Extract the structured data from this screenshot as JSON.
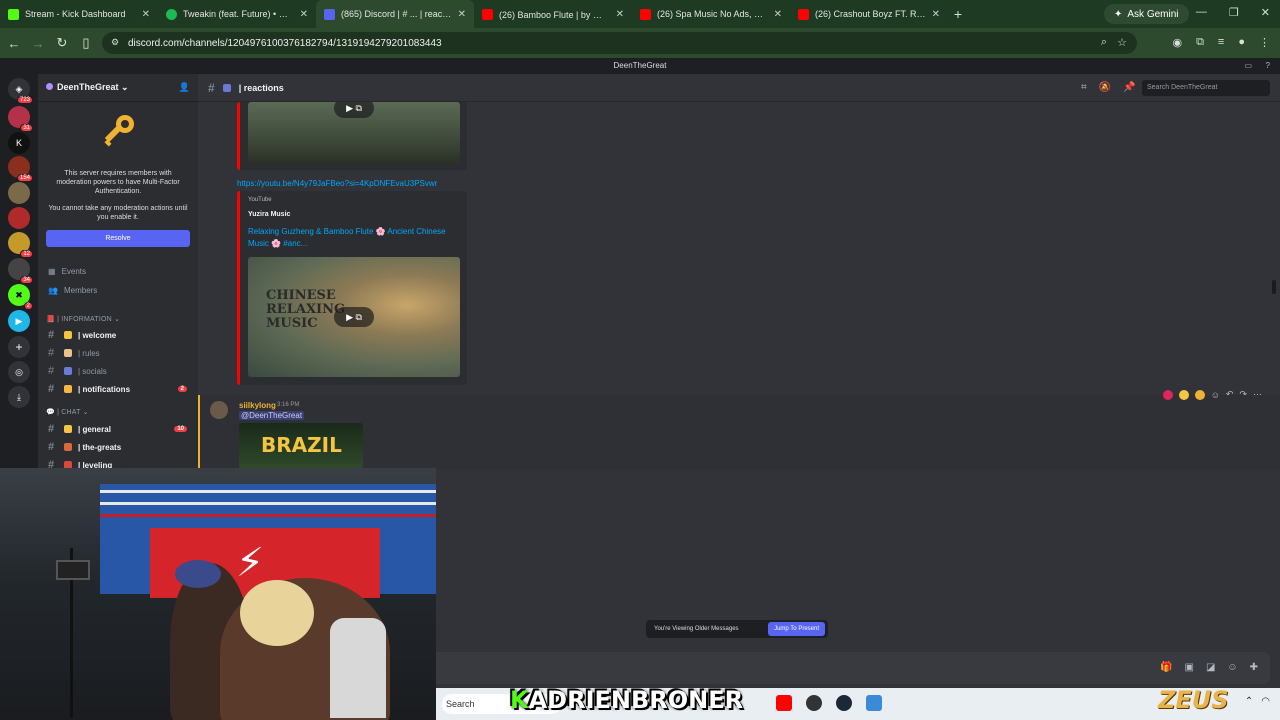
{
  "browser": {
    "tabs": [
      {
        "label": "Stream - Kick Dashboard",
        "color": "#53fc18"
      },
      {
        "label": "Tweakin (feat. Future) • Doe Bo...",
        "color": "#1db954"
      },
      {
        "label": "(865) Discord | # ... | reactions",
        "color": "#5865f2",
        "active": true
      },
      {
        "label": "(26) Bamboo Flute | by 陳悅 - Y...",
        "color": "#ff0000"
      },
      {
        "label": "(26) Spa Music No Ads, Relax M...",
        "color": "#ff0000"
      },
      {
        "label": "(26) Crashout Boyz FT. Ralfy- 19...",
        "color": "#ff0000"
      }
    ],
    "new_tab": "+",
    "ask_gemini": "Ask Gemini",
    "url": "discord.com/channels/1204976100376182794/1319194279201083443"
  },
  "discord": {
    "window_title": "DeenTheGreat",
    "rail": [
      {
        "badge": "723"
      },
      {
        "badge": "31"
      },
      {
        "badge": ""
      },
      {
        "badge": "154"
      },
      {
        "badge": ""
      },
      {
        "badge": ""
      },
      {
        "badge": "12"
      },
      {
        "badge": "34"
      },
      {
        "badge": "2"
      },
      {
        "badge": ""
      }
    ],
    "server_name": "DeenTheGreat",
    "mfa_notice": "This server requires members with moderation powers to have Multi-Factor Authentication.",
    "mfa_sub": "You cannot take any moderation actions until you enable it.",
    "resolve_label": "Resolve",
    "events_label": "Events",
    "members_label": "Members",
    "cat_information": "| INFORMATION ⌄",
    "cat_chat": "| CHAT ⌄",
    "channels": [
      {
        "name": "| welcome",
        "bright": true
      },
      {
        "name": "| rules"
      },
      {
        "name": "| socials"
      },
      {
        "name": "| notifications",
        "bright": true,
        "badge": "2"
      },
      {
        "name": "| general",
        "bright": true,
        "badge": "10"
      },
      {
        "name": "| the-greats",
        "bright": true
      },
      {
        "name": "| leveling",
        "bright": true
      }
    ],
    "channel_header": "| reactions",
    "search_placeholder": "Search DeenTheGreat",
    "message1": {
      "link": "https://youtu.be/N4y79JaFBeo?si=4KpDNFEvaU3PSvwr",
      "provider": "YouTube",
      "author": "Yuzira Music",
      "title": "Relaxing Guzheng & Bamboo Flute 🌸 Ancient Chinese Music 🌸 #anc...",
      "thumb_text": "CHINESE RELAXING MUSIC"
    },
    "message2": {
      "username": "siilkylong",
      "time": "3:16 PM",
      "mention": "@DeenTheGreat",
      "thumb_text": "BRAZIL"
    },
    "older_label": "You're Viewing Older Messages",
    "jump_label": "Jump To Present"
  },
  "taskbar": {
    "search": "Search"
  },
  "overlay": {
    "streamer_k": "K",
    "streamer_rest": "ADRIENBRONER",
    "brand": "ZEUS"
  },
  "colors": {
    "accent": "#5865f2",
    "youtube": "#ff0000",
    "kick": "#53fc18"
  }
}
